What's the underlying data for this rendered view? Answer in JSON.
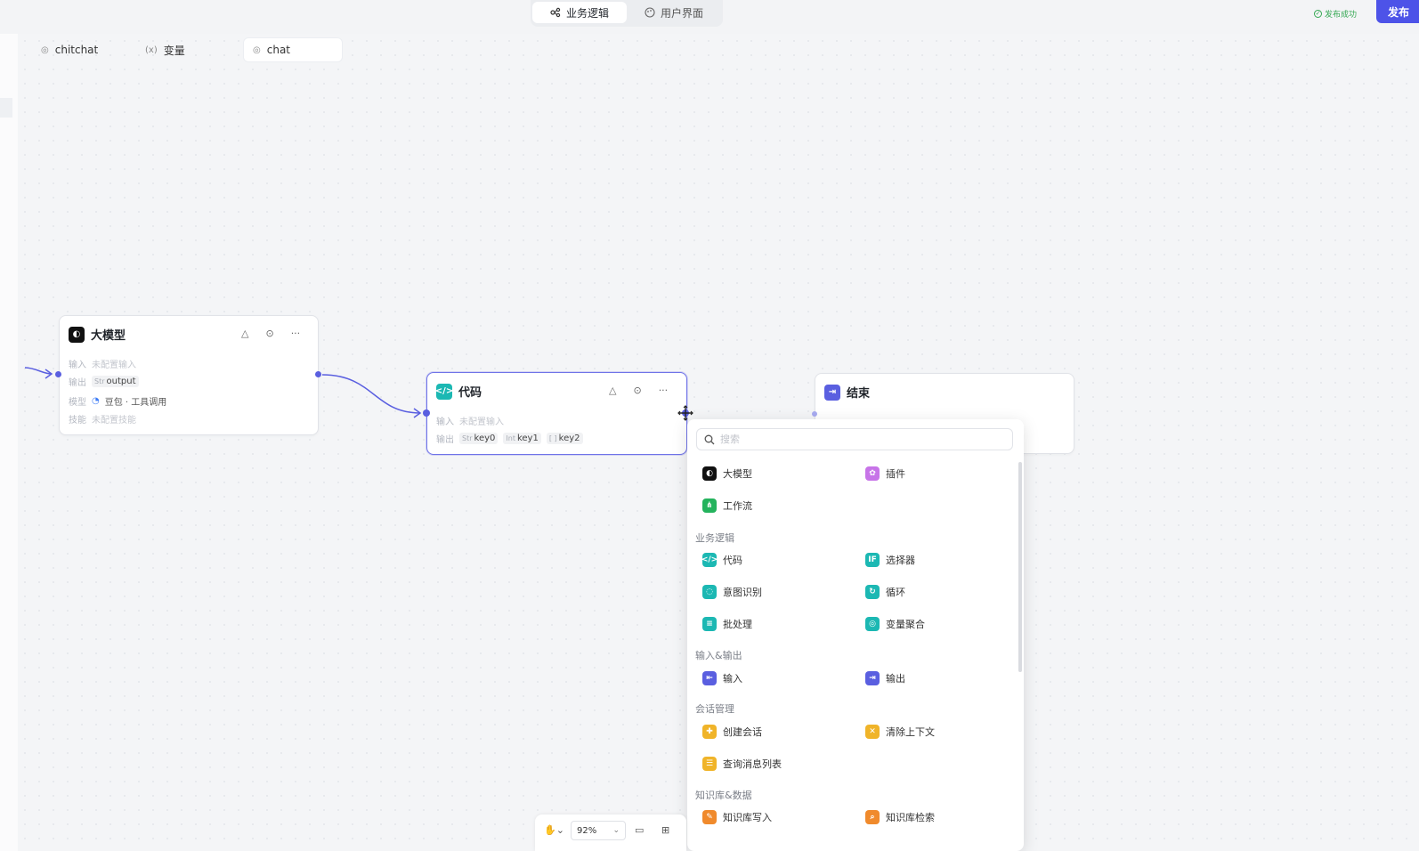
{
  "topbar": {
    "tabs": [
      {
        "label": "业务逻辑",
        "icon": "flow-icon",
        "active": true
      },
      {
        "label": "用户界面",
        "icon": "palette-icon",
        "active": false
      }
    ],
    "status": "发布成功",
    "publish_label": "发布"
  },
  "workflow_tabs": [
    {
      "label": "chitchat",
      "icon": "workflow-icon",
      "active": false
    },
    {
      "label": "变量",
      "icon": "variable-icon",
      "active": false
    },
    {
      "label": "chat",
      "icon": "workflow-icon",
      "active": true
    }
  ],
  "nodes": {
    "llm": {
      "title": "大模型",
      "input_label": "输入",
      "input_value": "未配置输入",
      "output_label": "输出",
      "output_chip": "output",
      "output_type": "Str",
      "model_label": "模型",
      "model_value": "豆包 · 工具调用",
      "skill_label": "技能",
      "skill_value": "未配置技能"
    },
    "code": {
      "title": "代码",
      "input_label": "输入",
      "input_value": "未配置输入",
      "output_label": "输出",
      "outputs": [
        {
          "type": "Str",
          "name": "key0"
        },
        {
          "type": "Int",
          "name": "key1"
        },
        {
          "type": "[ ]",
          "name": "key2"
        }
      ]
    },
    "end": {
      "title": "结束"
    }
  },
  "node_menu": {
    "search_placeholder": "搜索",
    "top_items": [
      {
        "label": "大模型",
        "color": "#111111"
      },
      {
        "label": "插件",
        "color": "#c774e8"
      },
      {
        "label": "工作流",
        "color": "#24b35d"
      }
    ],
    "categories": [
      {
        "title": "业务逻辑",
        "items": [
          {
            "label": "代码",
            "color": "#1cb8b3"
          },
          {
            "label": "选择器",
            "color": "#1cb8b3"
          },
          {
            "label": "意图识别",
            "color": "#1cb8b3"
          },
          {
            "label": "循环",
            "color": "#1cb8b3"
          },
          {
            "label": "批处理",
            "color": "#1cb8b3"
          },
          {
            "label": "变量聚合",
            "color": "#1cb8b3"
          }
        ]
      },
      {
        "title": "输入&输出",
        "items": [
          {
            "label": "输入",
            "color": "#5a5fe0"
          },
          {
            "label": "输出",
            "color": "#5a5fe0"
          }
        ]
      },
      {
        "title": "会话管理",
        "items": [
          {
            "label": "创建会话",
            "color": "#f0b429"
          },
          {
            "label": "清除上下文",
            "color": "#f0b429"
          },
          {
            "label": "查询消息列表",
            "color": "#f0b429"
          }
        ]
      },
      {
        "title": "知识库&数据",
        "items": [
          {
            "label": "知识库写入",
            "color": "#f08a2c"
          },
          {
            "label": "知识库检索",
            "color": "#f08a2c"
          }
        ]
      }
    ]
  },
  "toolbar": {
    "zoom": "92%"
  }
}
